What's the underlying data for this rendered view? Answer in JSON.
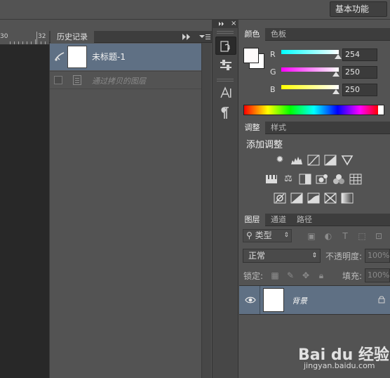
{
  "workspace": {
    "label": "基本功能"
  },
  "ruler": {
    "ticks": [
      "30",
      "32"
    ]
  },
  "history_panel": {
    "tab": "历史记录",
    "items": [
      {
        "label": "未标题-1",
        "icon": "history-brush-icon"
      },
      {
        "label": "通过拷贝的图层",
        "icon": "document-icon"
      }
    ]
  },
  "color_panel": {
    "tabs": [
      "颜色",
      "色板"
    ],
    "channels": [
      {
        "label": "R",
        "value": "254"
      },
      {
        "label": "G",
        "value": "250"
      },
      {
        "label": "B",
        "value": "250"
      }
    ],
    "foreground": "#fefafa",
    "background": "#ffffff"
  },
  "adjustments_panel": {
    "tabs": [
      "调整",
      "样式"
    ],
    "title": "添加调整"
  },
  "layers_panel": {
    "tabs": [
      "图层",
      "通道",
      "路径"
    ],
    "kind_filter": "类型",
    "blend_mode": "正常",
    "opacity_label": "不透明度:",
    "opacity_value": "100%",
    "lock_label": "锁定:",
    "fill_label": "填充:",
    "fill_value": "100%",
    "layer": {
      "name": "背景"
    }
  },
  "watermark": {
    "logo": "Bai du 经验",
    "url": "jingyan.baidu.com"
  }
}
